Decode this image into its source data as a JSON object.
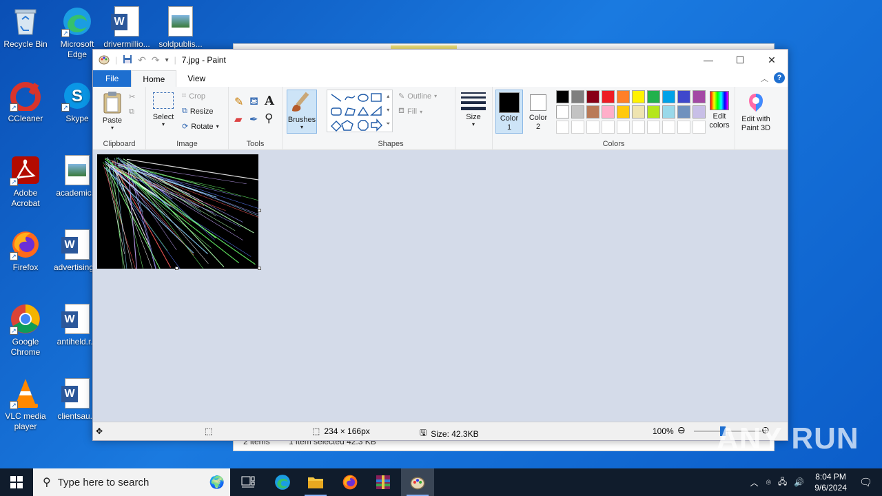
{
  "desktop": {
    "icons": [
      {
        "label": "Recycle Bin"
      },
      {
        "label": "Microsoft Edge"
      },
      {
        "label": "drivermillio..."
      },
      {
        "label": "soldpublis..."
      },
      {
        "label": "CCleaner"
      },
      {
        "label": "Skype"
      },
      {
        "label": "Adobe Acrobat"
      },
      {
        "label": "academic..."
      },
      {
        "label": "Firefox"
      },
      {
        "label": "advertising..."
      },
      {
        "label": "Google Chrome"
      },
      {
        "label": "antiheld.r..."
      },
      {
        "label": "VLC media player"
      },
      {
        "label": "clientsau..."
      }
    ]
  },
  "explorer": {
    "items_count": "2 items",
    "selection": "1 item selected  42.3 KB"
  },
  "paint": {
    "title": "7.jpg - Paint",
    "tabs": {
      "file": "File",
      "home": "Home",
      "view": "View"
    },
    "clipboard": {
      "paste": "Paste",
      "label": "Clipboard"
    },
    "image": {
      "select": "Select",
      "crop": "Crop",
      "resize": "Resize",
      "rotate": "Rotate",
      "label": "Image"
    },
    "tools": {
      "label": "Tools"
    },
    "brushes": {
      "label": "Brushes"
    },
    "shapes": {
      "outline": "Outline",
      "fill": "Fill",
      "label": "Shapes"
    },
    "size": {
      "label": "Size"
    },
    "colors": {
      "color1": "Color 1",
      "color2": "Color 2",
      "edit": "Edit colors",
      "label": "Colors",
      "palette_row1": [
        "#000000",
        "#7f7f7f",
        "#880015",
        "#ed1c24",
        "#ff7f27",
        "#fff200",
        "#22b14c",
        "#00a2e8",
        "#3f48cc",
        "#a349a4"
      ],
      "palette_row2": [
        "#ffffff",
        "#c3c3c3",
        "#b97a57",
        "#ffaec9",
        "#ffc90e",
        "#efe4b0",
        "#b5e61d",
        "#99d9ea",
        "#7092be",
        "#c8bfe7"
      ]
    },
    "paint3d": {
      "label": "Edit with Paint 3D"
    },
    "status": {
      "dimensions": "234 × 166px",
      "size": "Size: 42.3KB",
      "zoom": "100%"
    }
  },
  "taskbar": {
    "search_placeholder": "Type here to search",
    "time": "8:04 PM",
    "date": "9/6/2024"
  },
  "watermark": "ANY RUN"
}
